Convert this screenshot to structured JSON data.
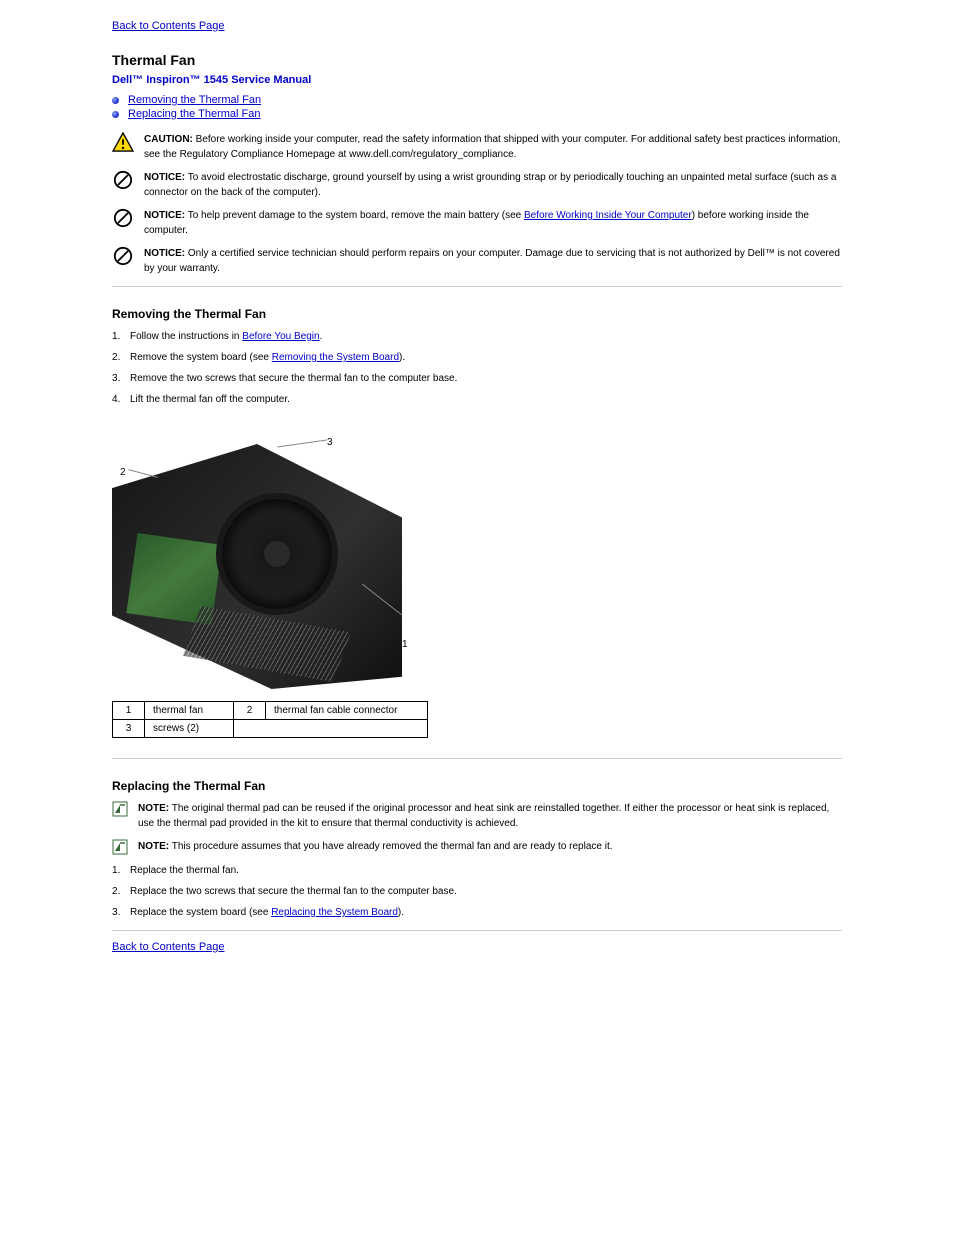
{
  "backLink": "Back to Contents Page",
  "pageHeading": "Thermal Fan",
  "manualTitle": "Dell™ Inspiron™ 1545 Service Manual",
  "tocLinks": [
    "Removing the Thermal Fan",
    "Replacing the Thermal Fan"
  ],
  "notices": {
    "caution": {
      "label": "CAUTION:",
      "text": "Before working inside your computer, read the safety information that shipped with your computer. For additional safety best practices information, see the Regulatory Compliance Homepage at www.dell.com/regulatory_compliance."
    },
    "esd": {
      "label": "NOTICE:",
      "text": "To avoid electrostatic discharge, ground yourself by using a wrist grounding strap or by periodically touching an unpainted metal surface (such as a connector on the back of the computer)."
    },
    "battery": {
      "label": "NOTICE:",
      "preText": "To help prevent damage to the system board, remove the main battery (see ",
      "linkText": "Before Working Inside Your Computer",
      "postText": ") before working inside the computer."
    },
    "tech": {
      "label": "NOTICE:",
      "text": "Only a certified service technician should perform repairs on your computer. Damage due to servicing that is not authorized by Dell™ is not covered by your warranty."
    }
  },
  "sectionRemove": {
    "heading": "Removing the Thermal Fan",
    "steps": [
      {
        "pre": "Follow the instructions in ",
        "link": "Before You Begin",
        "post": "."
      },
      {
        "pre": "Remove the system board (see ",
        "link": "Removing the System Board",
        "post": ")."
      },
      {
        "pre": "Remove the two screws that secure the thermal fan to the computer base."
      },
      {
        "pre": "Lift the thermal fan off the computer."
      }
    ]
  },
  "partsTable": [
    [
      "1",
      "thermal fan",
      "2",
      "thermal fan cable connector"
    ],
    [
      "3",
      "screws (2)"
    ]
  ],
  "sectionReplace": {
    "heading": "Replacing the Thermal Fan",
    "noteOriginalPad": {
      "label": "NOTE:",
      "text": "The original thermal pad can be reused if the original processor and heat sink are reinstalled together. If either the processor or heat sink is replaced, use the thermal pad provided in the kit to ensure that thermal conductivity is achieved."
    },
    "noteNewFan": {
      "label": "NOTE:",
      "text": "This procedure assumes that you have already removed the thermal fan and are ready to replace it."
    },
    "steps": [
      {
        "pre": "Replace the thermal fan."
      },
      {
        "pre": "Replace the two screws that secure the thermal fan to the computer base."
      },
      {
        "pre": "Replace the system board (see ",
        "link": "Replacing the System Board",
        "post": ")."
      }
    ]
  }
}
